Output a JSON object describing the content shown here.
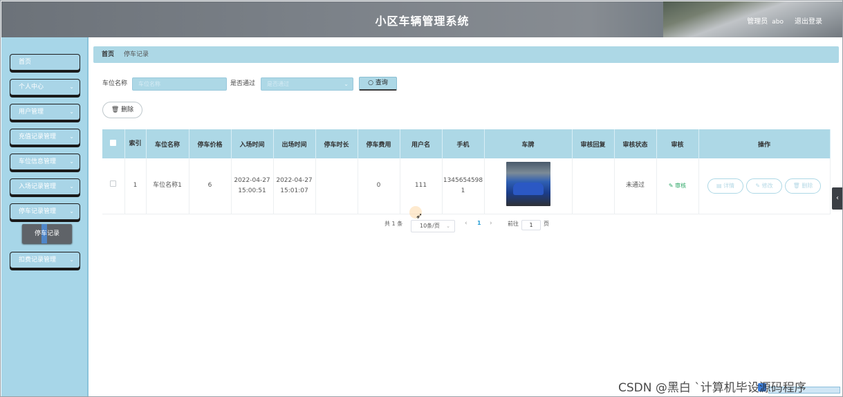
{
  "header": {
    "title": "小区车辆管理系统",
    "role": "管理员",
    "username": "abo",
    "logout": "退出登录"
  },
  "sidebar": {
    "items": [
      {
        "label": "首页",
        "chev": ""
      },
      {
        "label": "个人中心",
        "chev": "⌄"
      },
      {
        "label": "用户管理",
        "chev": "⌄"
      },
      {
        "label": "充值记录管理",
        "chev": "⌄"
      },
      {
        "label": "车位信息管理",
        "chev": "⌄"
      },
      {
        "label": "入场记录管理",
        "chev": "⌄"
      },
      {
        "label": "停车记录管理",
        "chev": "⌄"
      },
      {
        "label": "扣费记录管理",
        "chev": "⌄"
      }
    ],
    "active_sub": "停车记录"
  },
  "breadcrumb": {
    "home": "首页",
    "current": "停车记录"
  },
  "search": {
    "name_label": "车位名称",
    "name_placeholder": "车位名称",
    "pass_label": "是否通过",
    "pass_placeholder": "是否通过",
    "button": "查询",
    "button_icon": "search-icon"
  },
  "toolbar": {
    "delete": "删除",
    "delete_icon": "trash-icon"
  },
  "table": {
    "headers": [
      "",
      "索引",
      "车位名称",
      "停车价格",
      "入场时间",
      "出场时间",
      "停车时长",
      "停车费用",
      "用户名",
      "手机",
      "车牌",
      "审核回复",
      "审核状态",
      "审核",
      "操作"
    ],
    "rows": [
      {
        "index": "1",
        "spot_name": "车位名称1",
        "price": "6",
        "in_date": "2022-04-27",
        "in_time": "15:00:51",
        "out_date": "2022-04-27",
        "out_time": "15:01:07",
        "duration": "",
        "fee": "0",
        "username": "111",
        "phone_a": "1345654598",
        "phone_b": "1",
        "reply": "",
        "status": "未通过",
        "audit": "审核",
        "actions": {
          "detail": "详情",
          "edit": "修改",
          "delete": "删除"
        }
      }
    ]
  },
  "pagination": {
    "total_prefix": "共",
    "total": "1",
    "total_suffix": "条",
    "page_size": "10条/页",
    "current_page": "1",
    "goto_label": "前往",
    "goto_value": "1",
    "goto_suffix": "页"
  },
  "watermark": "CSDN @黑白 `计算机毕设源码程序"
}
